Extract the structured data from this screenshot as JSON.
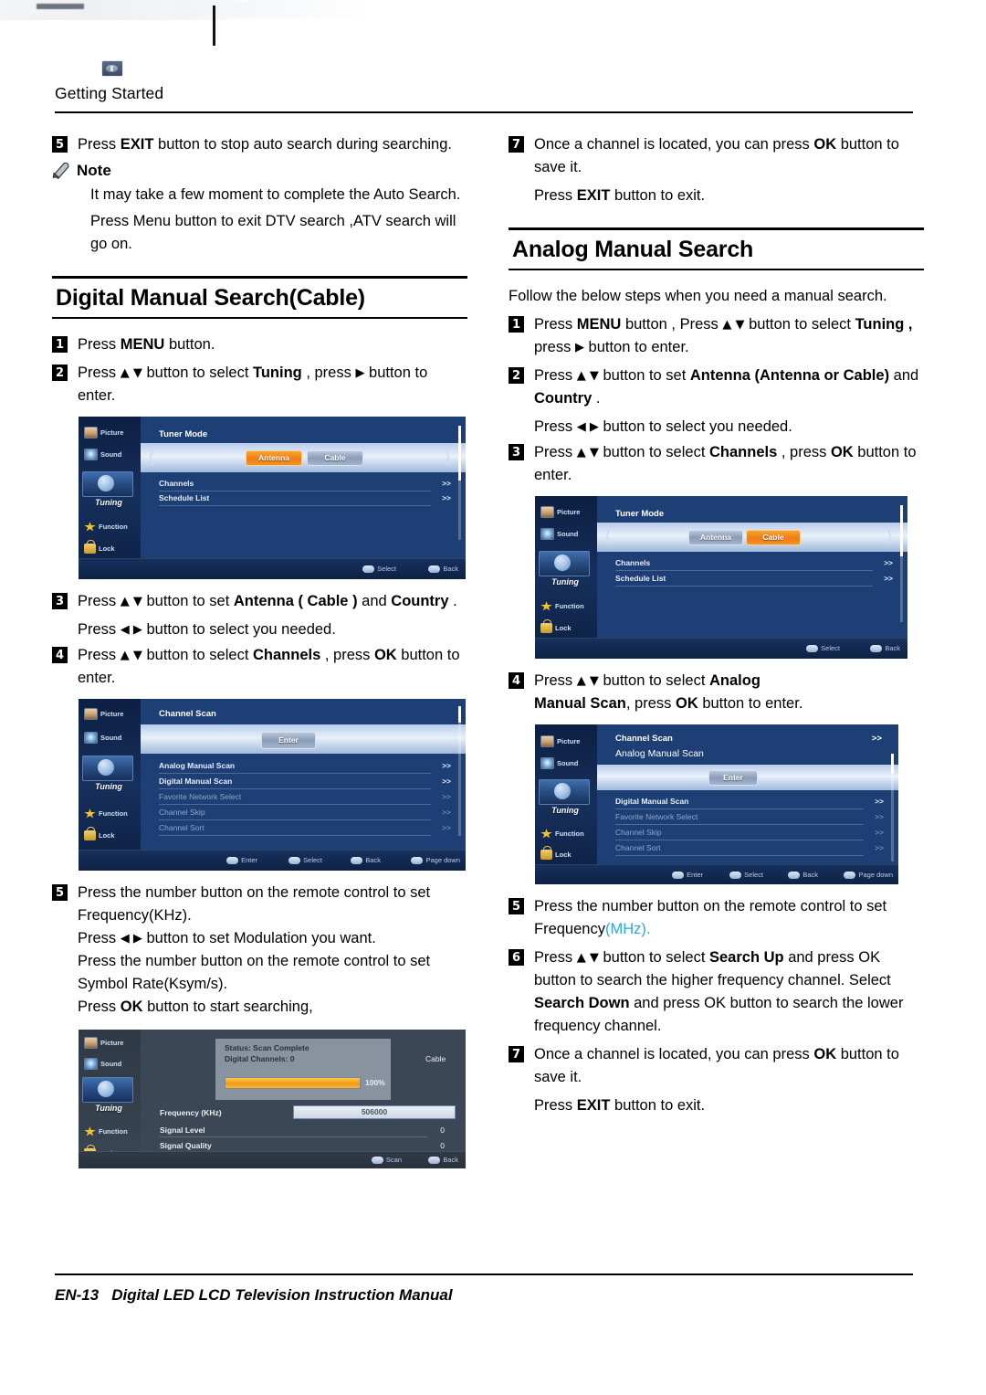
{
  "running_head": "Getting Started",
  "footer": {
    "page": "EN-13",
    "title": "Digital LED LCD Television Instruction Manual"
  },
  "icons": {
    "head_thumb": "tv-thumbnail-icon",
    "note": "pencil-icon"
  },
  "left_column": {
    "step5": {
      "num": "5",
      "line1_pre": "Press ",
      "line1_bold": "EXIT",
      "line1_post": " button to stop auto search during searching."
    },
    "note": {
      "label": "Note",
      "p1": "It may take a few moment to complete the Auto Search.",
      "p2": "Press Menu button to exit DTV search ,ATV search will go on."
    },
    "section_title": "Digital Manual Search(Cable)",
    "step1": {
      "num": "1",
      "pre": "Press ",
      "bold": "MENU",
      "post": " button."
    },
    "step2": {
      "num": "2",
      "pre": "Press ",
      "arrows": "▲ ▼",
      "mid": " button to select ",
      "bold": "Tuning",
      "mid2": " , press ",
      "arrow2": "▶",
      "post": " button to enter."
    },
    "step3": {
      "num": "3",
      "pre": "Press ",
      "arrows": "▲ ▼",
      "mid": " button to set ",
      "bold1": "Antenna ( Cable )",
      "mid2": " and ",
      "bold2": "Country",
      "post": " .",
      "sub_pre": "Press ",
      "sub_arrows": "◀  ▶",
      "sub_post": " button to select you needed."
    },
    "step4": {
      "num": "4",
      "pre": "Press ",
      "arrows": "▲ ▼",
      "mid": " button to select ",
      "bold1": "Channels",
      "mid2": " , press ",
      "bold2": "OK",
      "post": " button to enter."
    },
    "step5b": {
      "num": "5",
      "l1": "Press the number button on the remote control to set Frequency(KHz).",
      "l2_pre": "Press ",
      "l2_arrows": "◀  ▶",
      "l2_post": " button to set Modulation you want.",
      "l3": "Press the number button on the remote control to set Symbol Rate(Ksym/s).",
      "l4_pre": "Press ",
      "l4_bold": "OK",
      "l4_post": " button to start searching,"
    },
    "tv1": {
      "title": "Tuner Mode",
      "chip_antenna": "Antenna",
      "chip_cable": "Cable",
      "selected_chip": "Antenna",
      "rows": [
        {
          "label": "Channels",
          "right": ">>"
        },
        {
          "label": "Schedule List",
          "right": ">>"
        }
      ],
      "bottom_keys": [
        "Select",
        "Back"
      ]
    },
    "tv2": {
      "title": "Channel Scan",
      "button": "Enter",
      "rows": [
        {
          "label": "Analog Manual Scan",
          "right": ">>",
          "dim": false
        },
        {
          "label": "Digital Manual Scan",
          "right": ">>",
          "dim": false
        },
        {
          "label": "Favorite Network Select",
          "right": ">>",
          "dim": true
        },
        {
          "label": "Channel Skip",
          "right": ">>",
          "dim": true
        },
        {
          "label": "Channel Sort",
          "right": ">>",
          "dim": true
        }
      ],
      "bottom_keys": [
        "Enter",
        "Select",
        "Back",
        "Page down"
      ]
    },
    "tv3": {
      "status": "Status: Scan Complete",
      "channels": "Digital Channels: 0",
      "percent": "100%",
      "progress": 100,
      "mode": "Cable",
      "freq_label": "Frequency (KHz)",
      "freq_value": "506000",
      "signal_level_label": "Signal Level",
      "signal_level_value": "0",
      "signal_quality_label": "Signal Quality",
      "signal_quality_value": "0",
      "bottom_keys": [
        "Scan",
        "Back"
      ]
    }
  },
  "right_column": {
    "step7a": {
      "num": "7",
      "pre": "Once a channel is located, you can press ",
      "bold": "OK",
      "post": " button to save it.",
      "sub_pre": "Press ",
      "sub_bold": "EXIT",
      "sub_post": " button to exit."
    },
    "section_title": "Analog Manual Search",
    "intro": "Follow the below steps when you need a manual search.",
    "step1": {
      "num": "1",
      "pre": "Press ",
      "bold1": "MENU",
      "mid": " button , Press ",
      "arrows": "▲ ▼",
      "mid2": " button to select ",
      "bold2": "Tuning ,",
      "mid3": " press ",
      "arrow2": "▶",
      "post": " button to enter."
    },
    "step2": {
      "num": "2",
      "pre": "Press ",
      "arrows": "▲ ▼",
      "mid": " button to set ",
      "bold1": "Antenna (Antenna or Cable)",
      "mid2": " and ",
      "bold2": "Country",
      "post": " .",
      "sub_pre": "Press ",
      "sub_arrows": "◀  ▶",
      "sub_post": " button to select you needed."
    },
    "step3": {
      "num": "3",
      "pre": "Press ",
      "arrows": "▲ ▼",
      "mid": " button to select ",
      "bold1": "Channels",
      "mid2": " , press ",
      "bold2": "OK",
      "post": " button to enter."
    },
    "step4": {
      "num": "4",
      "pre": "Press ",
      "arrows": "▲ ▼",
      "mid": " button to select ",
      "bold1": "Analog",
      "bold2": "Manual Scan",
      "mid2": ", press ",
      "bold3": "OK",
      "post": "  button to enter."
    },
    "step5": {
      "num": "5",
      "l1": "Press the number button on the remote control to set Frequency",
      "l1_cyan": "(MHz)."
    },
    "step6": {
      "num": "6",
      "pre": "Press ",
      "arrows": "▲ ▼",
      "mid": " button to select ",
      "bold1": "Search Up",
      "post": " and press OK button to search the higher frequency channel.",
      "l2_pre": "Select ",
      "l2_bold": "Search Down",
      "l2_post": " and press OK button to search the lower frequency channel."
    },
    "step7": {
      "num": "7",
      "pre": "Once a channel is located, you can press ",
      "bold": "OK",
      "post": " button to save it.",
      "sub_pre": "Press ",
      "sub_bold": "EXIT",
      "sub_post": " button to exit."
    },
    "tv1": {
      "title": "Tuner Mode",
      "chip_antenna": "Antenna",
      "chip_cable": "Cable",
      "selected_chip": "Cable",
      "rows": [
        {
          "label": "Channels",
          "right": ">>"
        },
        {
          "label": "Schedule List",
          "right": ">>"
        }
      ],
      "bottom_keys": [
        "Select",
        "Back"
      ]
    },
    "tv2": {
      "title": "Channel Scan",
      "title_right": ">>",
      "subtitle": "Analog Manual Scan",
      "button": "Enter",
      "rows": [
        {
          "label": "Digital Manual Scan",
          "right": ">>",
          "dim": false
        },
        {
          "label": "Favorite Network Select",
          "right": ">>",
          "dim": true
        },
        {
          "label": "Channel Skip",
          "right": ">>",
          "dim": true
        },
        {
          "label": "Channel Sort",
          "right": ">>",
          "dim": true
        }
      ],
      "bottom_keys": [
        "Enter",
        "Select",
        "Back",
        "Page down"
      ]
    }
  },
  "colors": {
    "accent_orange": "#ef7c18",
    "osd_blue": "#1d3f76",
    "cyan_text": "#29a8e0"
  }
}
